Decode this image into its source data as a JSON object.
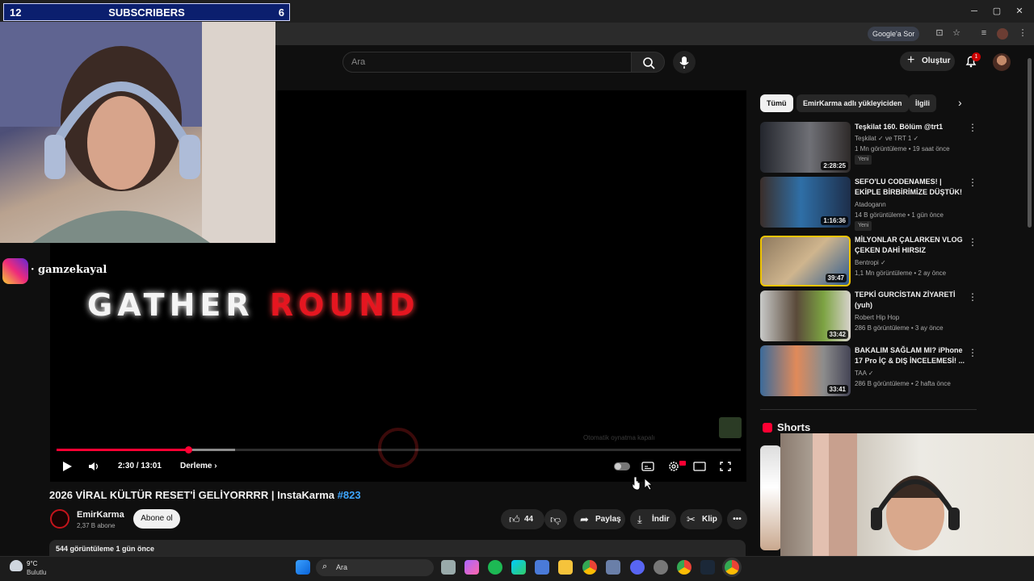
{
  "overlay": {
    "left_count": "12",
    "label": "SUBSCRIBERS",
    "right_count": "6"
  },
  "browser": {
    "google_sor": "Google'a Sor",
    "win_minimize": "─",
    "win_maximize": "▢",
    "win_close": "✕"
  },
  "header": {
    "search_placeholder": "Ara",
    "create_label": "Oluştur",
    "notification_count": "1"
  },
  "stream": {
    "instagram_handle": "· gamzekayal",
    "gather_word": "GATHER",
    "round_word": "ROUND"
  },
  "player": {
    "current_time": "2:30",
    "duration": "13:01",
    "time_display": "2:30 / 13:01",
    "progress": 0.192,
    "chapter_label": "Derleme",
    "autoplay_note": "Otomatik oynatma kapalı"
  },
  "video": {
    "title": "2026 VİRAL KÜLTÜR RESET'İ GELİYORRRR | InstaKarma",
    "title_tag": "#823",
    "channel_name": "EmirKarma",
    "channel_subs": "2,37 B abone",
    "subscribe_label": "Abone ol",
    "like_count": "44",
    "share_label": "Paylaş",
    "download_label": "İndir",
    "clip_label": "Klip",
    "views_and_date": "544 görüntüleme  1 gün önce"
  },
  "sidebar": {
    "chips": [
      "Tümü",
      "EmirKarma adlı yükleyiciden",
      "İlgili"
    ],
    "recommendations": [
      {
        "title": "Teşkilat 160. Bölüm @trt1",
        "channel": "Teşkilat ✓ ve TRT 1 ✓",
        "meta": "1 Mn görüntüleme • 19 saat önce",
        "duration": "2:28:25",
        "badge": "Yeni"
      },
      {
        "title": "SEFO'LU CODENAMES! | EKİPLE BİRBİRİMİZE DÜŞTÜK!",
        "channel": "Atadogann",
        "meta": "14 B görüntüleme • 1 gün önce",
        "duration": "1:16:36",
        "badge": "Yeni"
      },
      {
        "title": "MİLYONLAR ÇALARKEN VLOG ÇEKEN DAHİ HIRSIZ",
        "channel": "Bentropi ✓",
        "meta": "1,1 Mn görüntüleme • 2 ay önce",
        "duration": "39:47",
        "badge": ""
      },
      {
        "title": "TEPKİ GURCİSTAN ZİYARETİ (yuh)",
        "channel": "Robert Hip Hop",
        "meta": "286 B görüntüleme • 3 ay önce",
        "duration": "33:42",
        "badge": ""
      },
      {
        "title": "BAKALIM SAĞLAM MI? iPhone 17 Pro İÇ & DIŞ İNCELEMESİ! ...",
        "channel": "TAA ✓",
        "meta": "286 B görüntüleme • 2 hafta önce",
        "duration": "33:41",
        "badge": ""
      }
    ],
    "shorts_label": "Shorts"
  },
  "taskbar": {
    "temperature": "9°C",
    "weather": "Bulutlu",
    "search_label": "Ara"
  },
  "colors": {
    "accent": "#ff0033",
    "link": "#3ea6ff",
    "background": "#0f0f0f"
  }
}
